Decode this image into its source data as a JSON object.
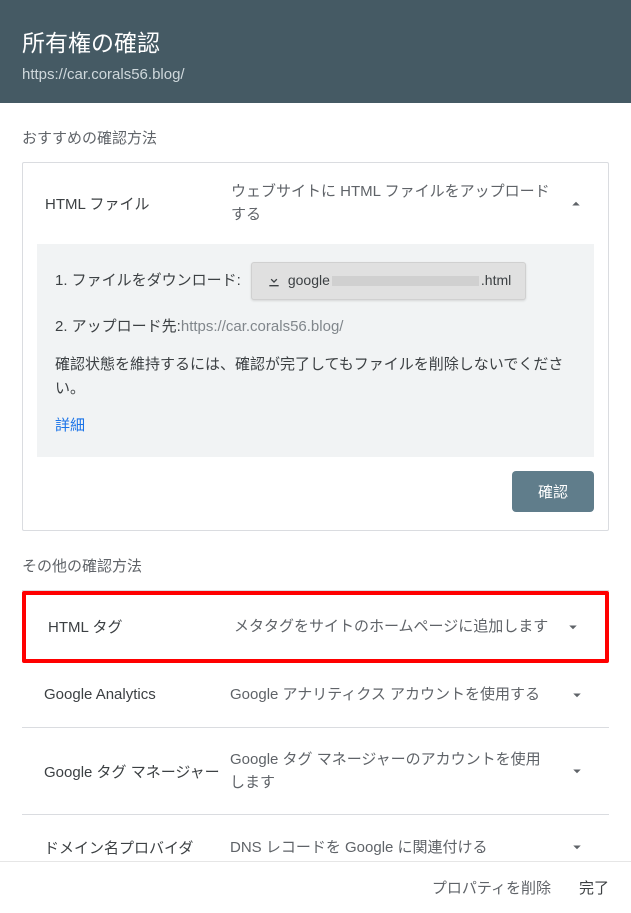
{
  "header": {
    "title": "所有権の確認",
    "url": "https://car.corals56.blog/"
  },
  "recommended": {
    "label": "おすすめの確認方法",
    "method": {
      "title": "HTML ファイル",
      "desc": "ウェブサイトに HTML ファイルをアップロードする",
      "step1_label": "1. ファイルをダウンロード:",
      "download_prefix": "google",
      "download_suffix": ".html",
      "step2_label": "2. アップロード先: ",
      "upload_url": "https://car.corals56.blog/",
      "note": "確認状態を維持するには、確認が完了してもファイルを削除しないでください。",
      "details": "詳細",
      "confirm": "確認"
    }
  },
  "other": {
    "label": "その他の確認方法",
    "methods": [
      {
        "title": "HTML タグ",
        "desc": "メタタグをサイトのホームページに追加します"
      },
      {
        "title": "Google Analytics",
        "desc": "Google アナリティクス アカウントを使用する"
      },
      {
        "title": "Google タグ マネージャー",
        "desc": "Google タグ マネージャーのアカウントを使用します"
      },
      {
        "title": "ドメイン名プロバイダ",
        "desc": "DNS レコードを Google に関連付ける"
      }
    ]
  },
  "footer": {
    "delete": "プロパティを削除",
    "done": "完了"
  }
}
